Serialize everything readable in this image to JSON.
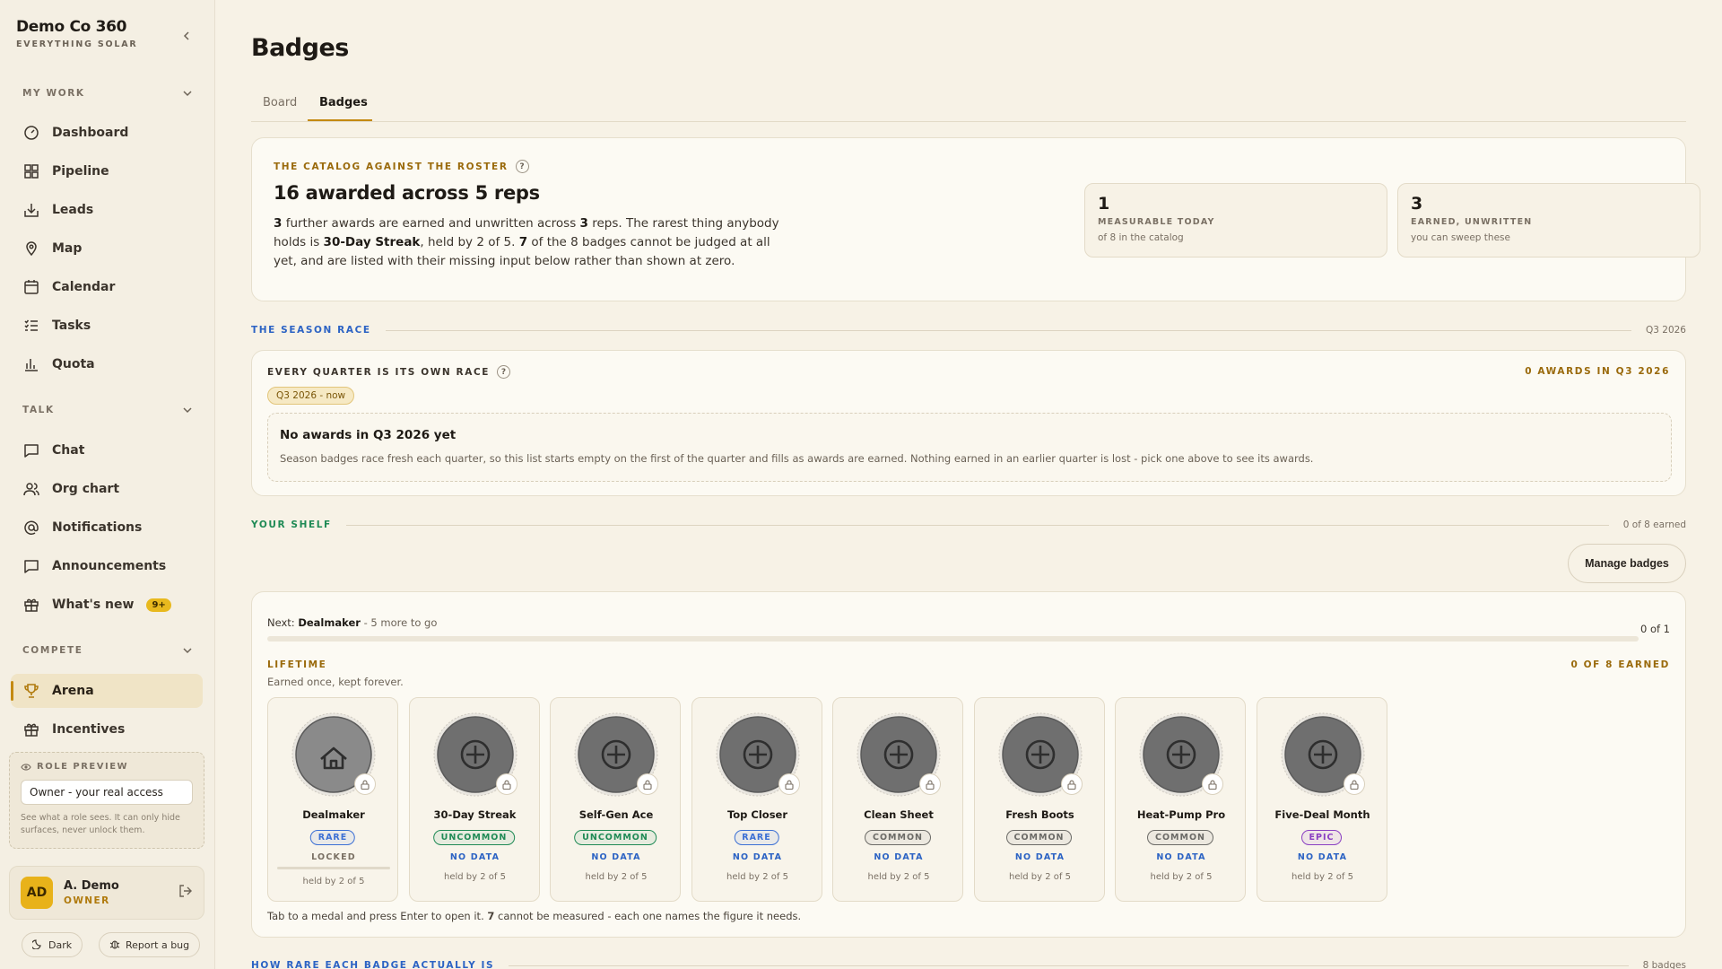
{
  "brand": {
    "name": "Demo Co 360",
    "tagline": "EVERYTHING SOLAR"
  },
  "sidebar": {
    "sections": [
      {
        "label": "MY WORK"
      },
      {
        "label": "TALK"
      },
      {
        "label": "COMPETE"
      }
    ],
    "items": [
      {
        "label": "Dashboard",
        "icon": "dashboard-icon"
      },
      {
        "label": "Pipeline",
        "icon": "pipeline-icon"
      },
      {
        "label": "Leads",
        "icon": "inbox-icon"
      },
      {
        "label": "Map",
        "icon": "map-pin-icon"
      },
      {
        "label": "Calendar",
        "icon": "calendar-icon"
      },
      {
        "label": "Tasks",
        "icon": "tasks-icon"
      },
      {
        "label": "Quota",
        "icon": "bar-chart-icon"
      },
      {
        "label": "Chat",
        "icon": "chat-icon"
      },
      {
        "label": "Org chart",
        "icon": "users-icon"
      },
      {
        "label": "Notifications",
        "icon": "at-icon"
      },
      {
        "label": "Announcements",
        "icon": "message-icon"
      },
      {
        "label": "What's new",
        "icon": "gift-icon",
        "badge": "9+"
      },
      {
        "label": "Arena",
        "icon": "trophy-icon",
        "active": true
      },
      {
        "label": "Incentives",
        "icon": "gift-icon"
      }
    ],
    "role_preview": {
      "title": "ROLE PREVIEW",
      "value": "Owner - your real access",
      "note": "See what a role sees. It can only hide surfaces, never unlock them."
    },
    "user": {
      "initials": "AD",
      "name": "A. Demo",
      "role": "OWNER"
    },
    "footer": {
      "dark_label": "Dark",
      "bug_label": "Report a bug"
    }
  },
  "page": {
    "title": "Badges",
    "tabs": [
      {
        "label": "Board"
      },
      {
        "label": "Badges",
        "active": true
      }
    ]
  },
  "catalog": {
    "eyebrow": "THE CATALOG AGAINST THE ROSTER",
    "title": "16 awarded across 5 reps",
    "text": {
      "a": "3",
      "b": " further awards are earned and unwritten across ",
      "c": "3",
      "d": " reps. The rarest thing anybody holds is ",
      "e": "30-Day Streak",
      "f": ", held by 2 of 5. ",
      "g": "7",
      "h": " of the 8 badges cannot be judged at all yet, and are listed with their missing input below rather than shown at zero."
    },
    "stats": [
      {
        "num": "1",
        "label": "MEASURABLE TODAY",
        "sub": "of 8 in the catalog"
      },
      {
        "num": "3",
        "label": "EARNED, UNWRITTEN",
        "sub": "you can sweep these"
      }
    ]
  },
  "season": {
    "section_label": "THE SEASON RACE",
    "section_right": "Q3 2026",
    "eyebrow": "EVERY QUARTER IS ITS OWN RACE",
    "right_label": "0 AWARDS IN Q3 2026",
    "tag": "Q3 2026 - now",
    "empty_title": "No awards in Q3 2026 yet",
    "empty_text": "Season badges race fresh each quarter, so this list starts empty on the first of the quarter and fills as awards are earned. Nothing earned in an earlier quarter is lost - pick one above to see its awards."
  },
  "shelf": {
    "section_label": "YOUR SHELF",
    "section_right": "0 of 8 earned",
    "manage_label": "Manage badges",
    "next_prefix": "Next: ",
    "next_name": "Dealmaker",
    "next_suffix": " - 5 more to go",
    "next_count": "0 of 1",
    "next_progress": 0,
    "group_label": "LIFETIME",
    "group_sub": "Earned once, kept forever.",
    "group_right": "0 OF 8 EARNED",
    "footer": {
      "a": "Tab to a medal and press Enter to open it. ",
      "b": "7",
      "c": " cannot be measured - each one names the figure it needs."
    },
    "badges": [
      {
        "name": "Dealmaker",
        "rarity": "RARE",
        "status": "LOCKED",
        "held": "held by 2 of 5",
        "icon": "house-icon",
        "progress": 0
      },
      {
        "name": "30-Day Streak",
        "rarity": "UNCOMMON",
        "status": "NO DATA",
        "held": "held by 2 of 5",
        "icon": "plus-circle-icon"
      },
      {
        "name": "Self-Gen Ace",
        "rarity": "UNCOMMON",
        "status": "NO DATA",
        "held": "held by 2 of 5",
        "icon": "plus-circle-icon"
      },
      {
        "name": "Top Closer",
        "rarity": "RARE",
        "status": "NO DATA",
        "held": "held by 2 of 5",
        "icon": "plus-circle-icon"
      },
      {
        "name": "Clean Sheet",
        "rarity": "COMMON",
        "status": "NO DATA",
        "held": "held by 2 of 5",
        "icon": "plus-circle-icon"
      },
      {
        "name": "Fresh Boots",
        "rarity": "COMMON",
        "status": "NO DATA",
        "held": "held by 2 of 5",
        "icon": "plus-circle-icon"
      },
      {
        "name": "Heat-Pump Pro",
        "rarity": "COMMON",
        "status": "NO DATA",
        "held": "held by 2 of 5",
        "icon": "plus-circle-icon"
      },
      {
        "name": "Five-Deal Month",
        "rarity": "EPIC",
        "status": "NO DATA",
        "held": "held by 2 of 5",
        "icon": "plus-circle-icon"
      }
    ]
  },
  "rarity_section": {
    "label": "HOW RARE EACH BADGE ACTUALLY IS",
    "right": "8 badges"
  },
  "colors": {
    "accent": "#c48a12",
    "rare": "#3b6fd4",
    "uncommon": "#1f8a55",
    "common": "#6b6a66",
    "epic": "#8a3fc2",
    "season": "#2c63c4",
    "shelf": "#1f8a55"
  }
}
